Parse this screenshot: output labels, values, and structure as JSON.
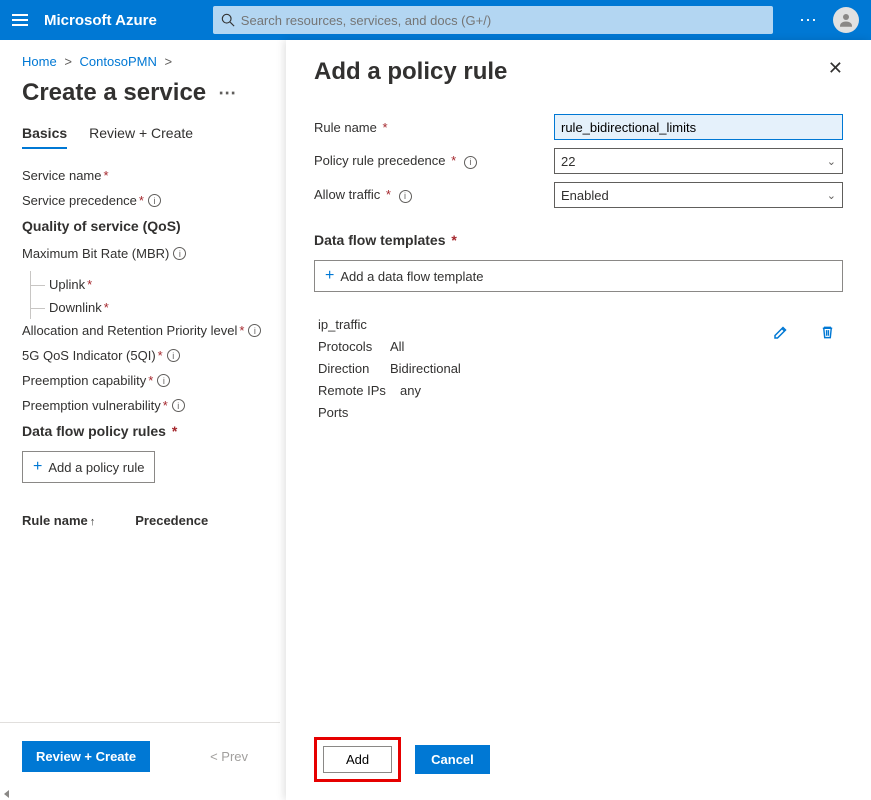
{
  "topbar": {
    "brand": "Microsoft Azure",
    "search_placeholder": "Search resources, services, and docs (G+/)"
  },
  "breadcrumb": {
    "home": "Home",
    "contoso": "ContosoPMN"
  },
  "page": {
    "title": "Create a service"
  },
  "tabs": {
    "basics": "Basics",
    "review": "Review + Create"
  },
  "left_fields": {
    "service_name": "Service name",
    "service_precedence": "Service precedence",
    "qos_heading": "Quality of service (QoS)",
    "mbr_label": "Maximum Bit Rate (MBR)",
    "uplink": "Uplink",
    "downlink": "Downlink",
    "arp": "Allocation and Retention Priority level",
    "fiveqi": "5G QoS Indicator (5QI)",
    "preempt_cap": "Preemption capability",
    "preempt_vuln": "Preemption vulnerability",
    "dfpr_heading": "Data flow policy rules",
    "add_policy_rule": "Add a policy rule",
    "col_rule_name": "Rule name",
    "col_precedence": "Precedence"
  },
  "bottom": {
    "review_create": "Review + Create",
    "prev": "< Prev"
  },
  "panel": {
    "title": "Add a policy rule",
    "rule_name_label": "Rule name",
    "rule_name_value": "rule_bidirectional_limits",
    "precedence_label": "Policy rule precedence",
    "precedence_value": "22",
    "allow_traffic_label": "Allow traffic",
    "allow_traffic_value": "Enabled",
    "templates_heading": "Data flow templates",
    "add_template": "Add a data flow template",
    "template": {
      "name": "ip_traffic",
      "protocols_label": "Protocols",
      "protocols_value": "All",
      "direction_label": "Direction",
      "direction_value": "Bidirectional",
      "remote_ips_label": "Remote IPs",
      "remote_ips_value": "any",
      "ports_label": "Ports",
      "ports_value": ""
    },
    "add_btn": "Add",
    "cancel_btn": "Cancel"
  }
}
